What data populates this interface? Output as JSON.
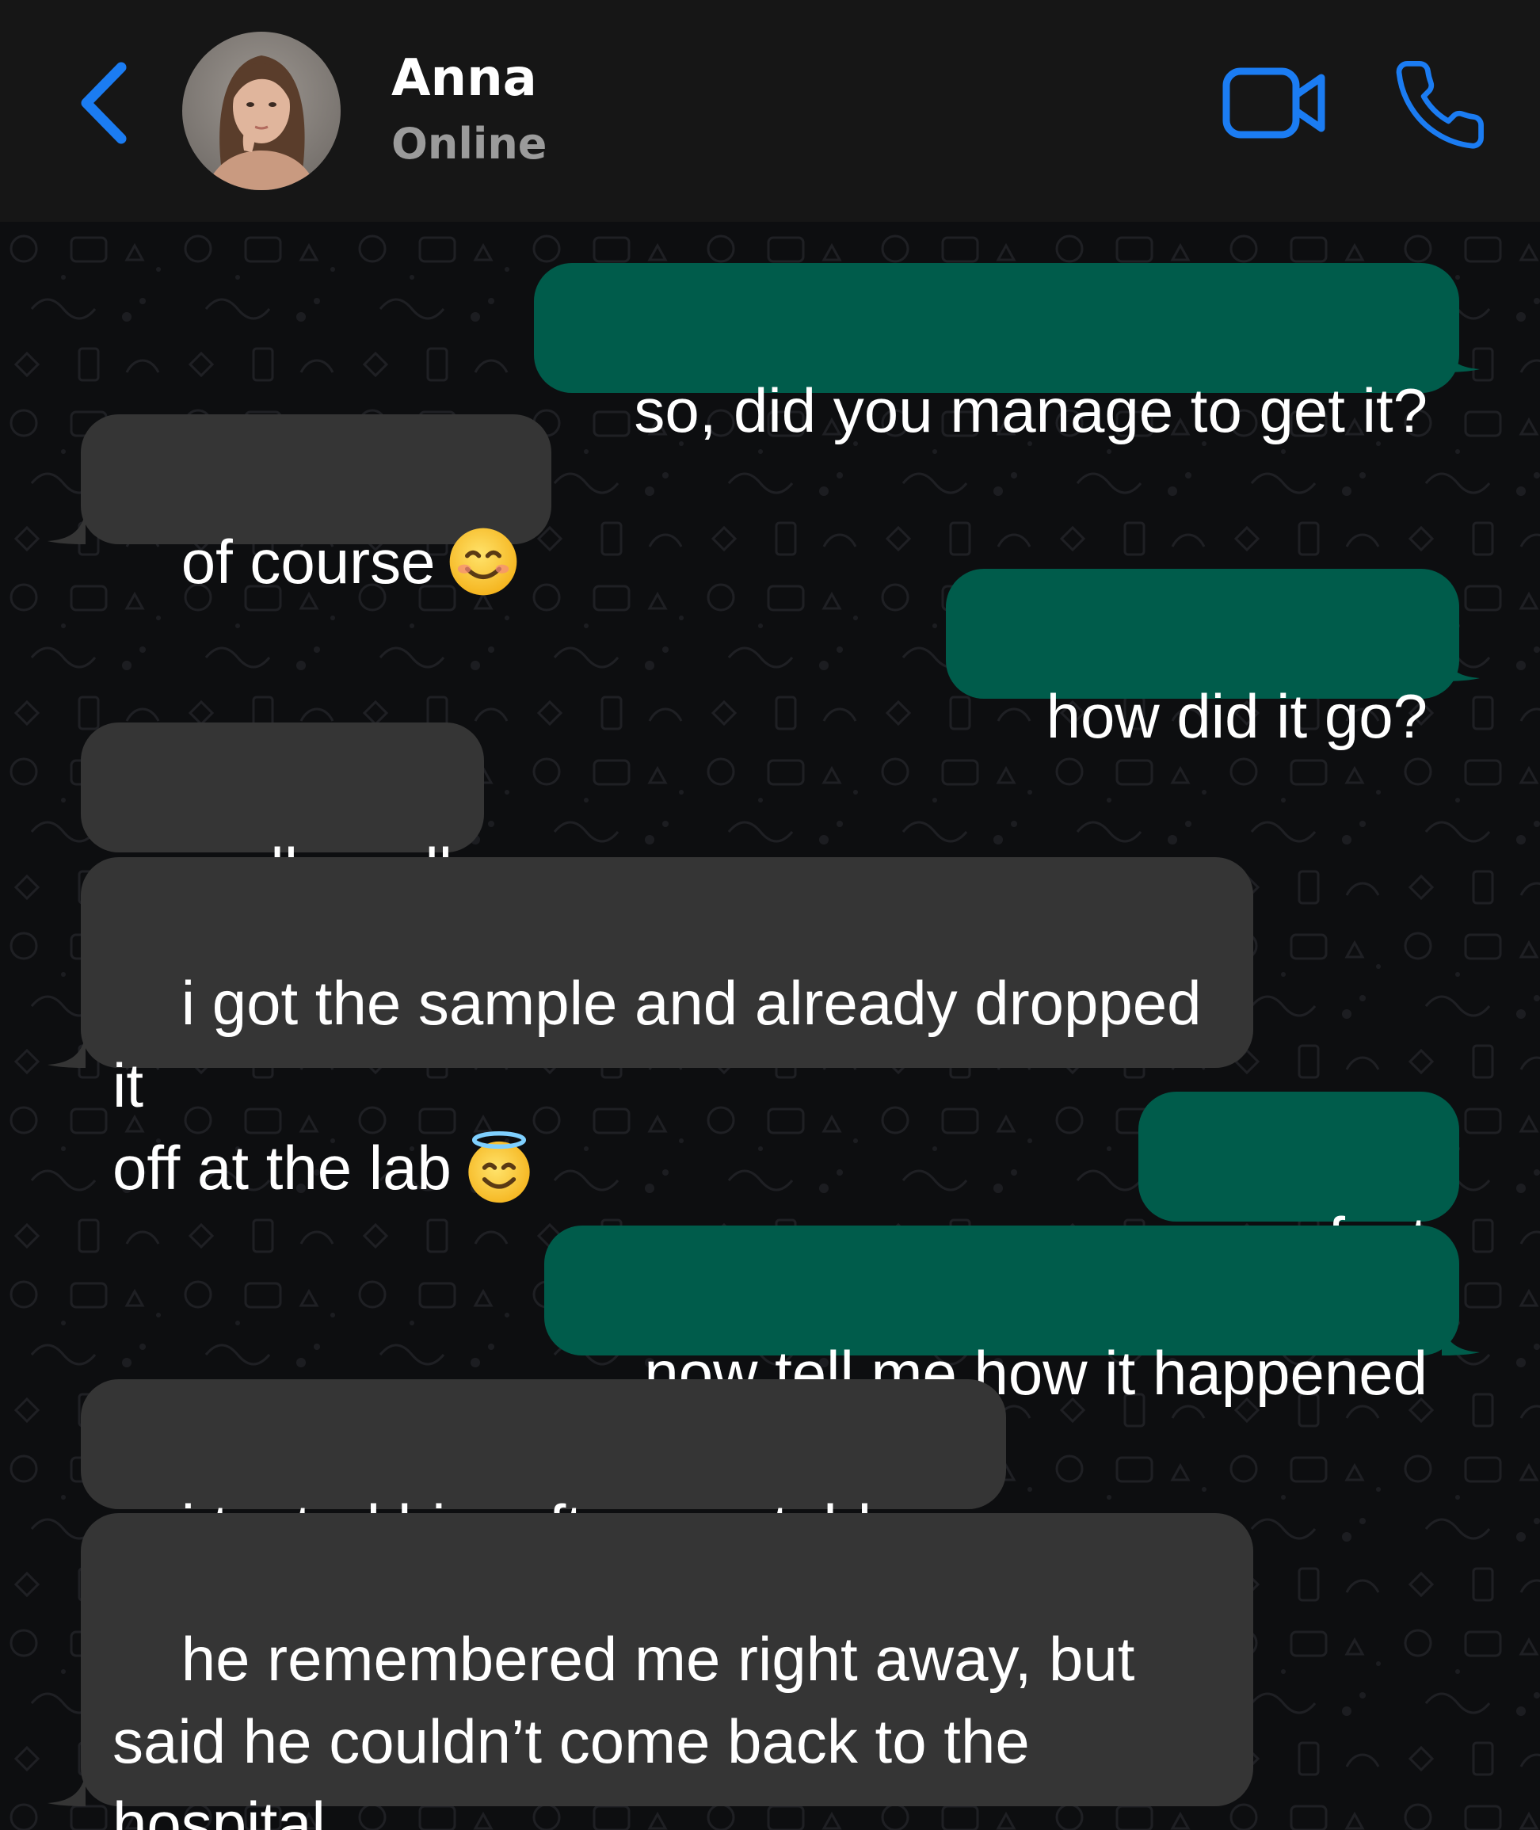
{
  "colors": {
    "header_bg": "#161616",
    "accent_blue": "#1b7cf2",
    "outgoing_bubble": "#005c4b",
    "incoming_bubble": "#353535",
    "chat_bg": "#0d0e10"
  },
  "header": {
    "back_icon": "chevron-left-icon",
    "contact_name": "Anna",
    "contact_status": "Online",
    "video_icon": "video-camera-icon",
    "call_icon": "phone-icon"
  },
  "messages": [
    {
      "direction": "outgoing",
      "text": "so, did you manage to get it?"
    },
    {
      "direction": "incoming",
      "text": "of course",
      "emoji": "smiling-face-icon"
    },
    {
      "direction": "outgoing",
      "text": "how did it go?"
    },
    {
      "direction": "incoming",
      "text": "really well"
    },
    {
      "direction": "incoming",
      "text": "i got the sample and already dropped it\noff at the lab",
      "emoji": "smiling-face-with-halo-icon"
    },
    {
      "direction": "outgoing",
      "text": "perfect"
    },
    {
      "direction": "outgoing",
      "text": "now tell me how it happened"
    },
    {
      "direction": "incoming",
      "text": "i texted him after you told me"
    },
    {
      "direction": "incoming",
      "text": "he remembered me right away, but\nsaid he couldn’t come back to the\nhospital"
    }
  ]
}
